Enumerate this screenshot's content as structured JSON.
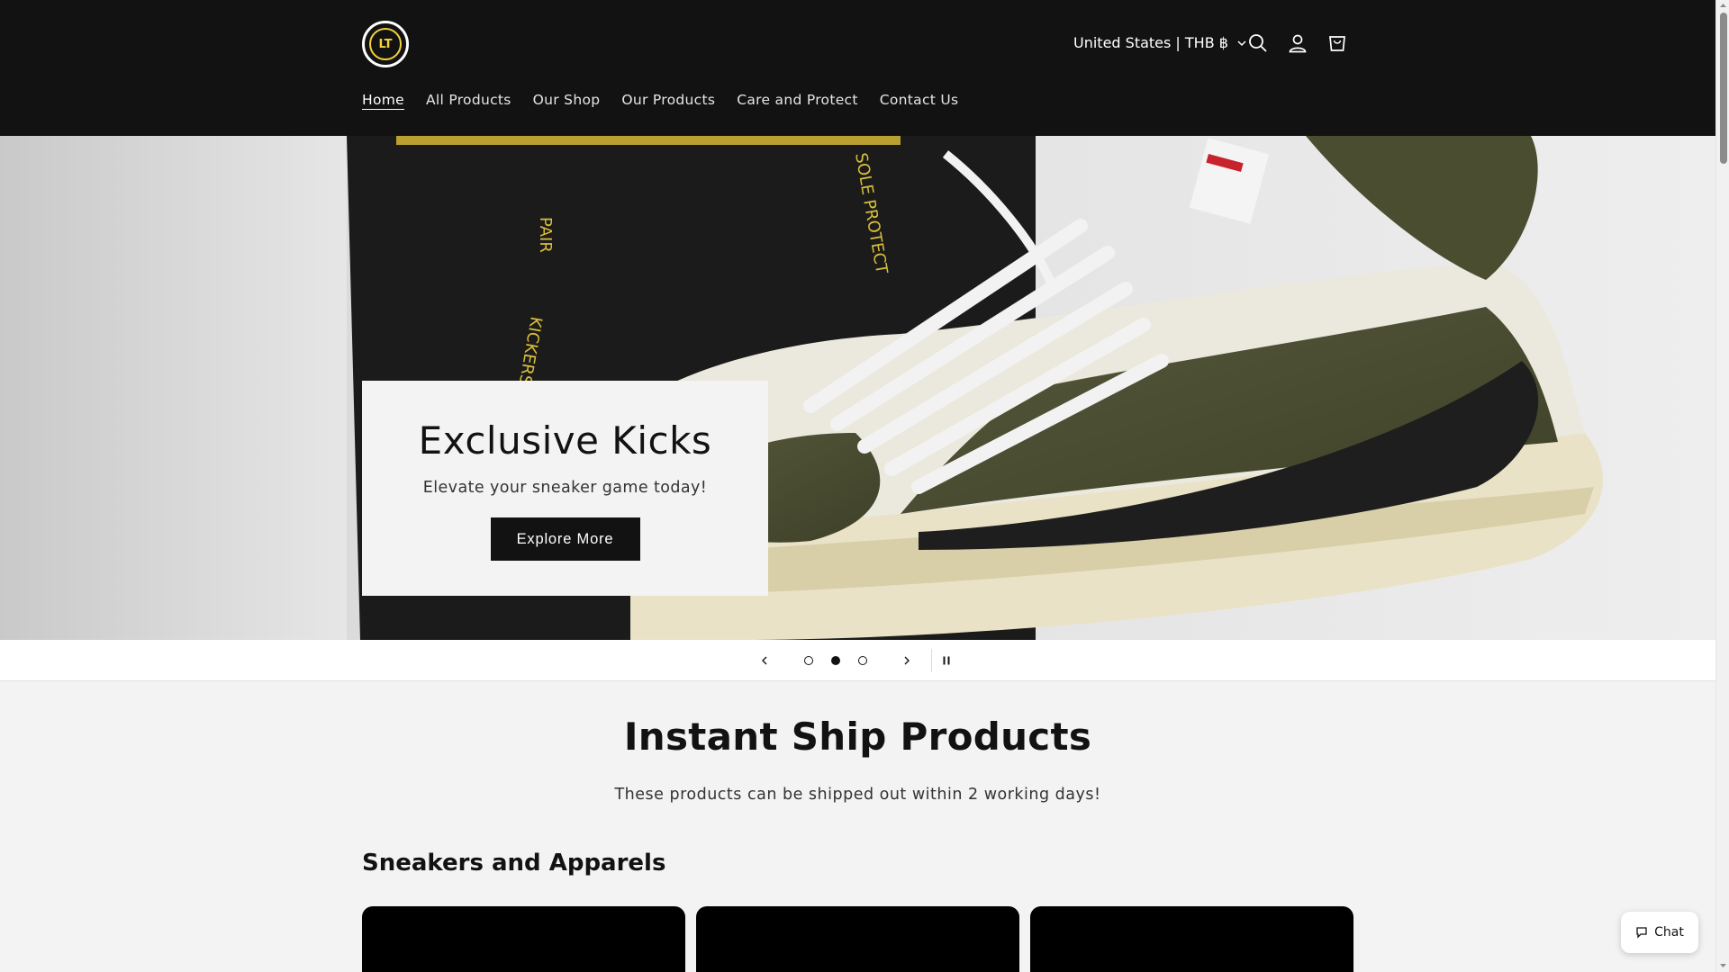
{
  "header": {
    "logo_text": "LT",
    "country_selector": "United States | THB ฿",
    "icons": [
      "search-icon",
      "account-icon",
      "cart-icon"
    ],
    "nav": [
      {
        "label": "Home",
        "active": true
      },
      {
        "label": "All Products",
        "active": false
      },
      {
        "label": "Our Shop",
        "active": false
      },
      {
        "label": "Our Products",
        "active": false
      },
      {
        "label": "Care and Protect",
        "active": false
      },
      {
        "label": "Contact Us",
        "active": false
      }
    ]
  },
  "hero": {
    "title": "Exclusive Kicks",
    "subtitle": "Elevate your sneaker game today!",
    "button_label": "Explore More",
    "slide_count": 3,
    "active_slide": 2
  },
  "instant_ship": {
    "title": "Instant Ship Products",
    "subtitle": "These products can be shipped out within 2 working days!",
    "collection_title": "Sneakers and Apparels"
  },
  "chat": {
    "label": "Chat"
  },
  "colors": {
    "header_bg": "#121212",
    "page_bg": "#f3f3f3",
    "accent_logo": "#f2d33b"
  }
}
